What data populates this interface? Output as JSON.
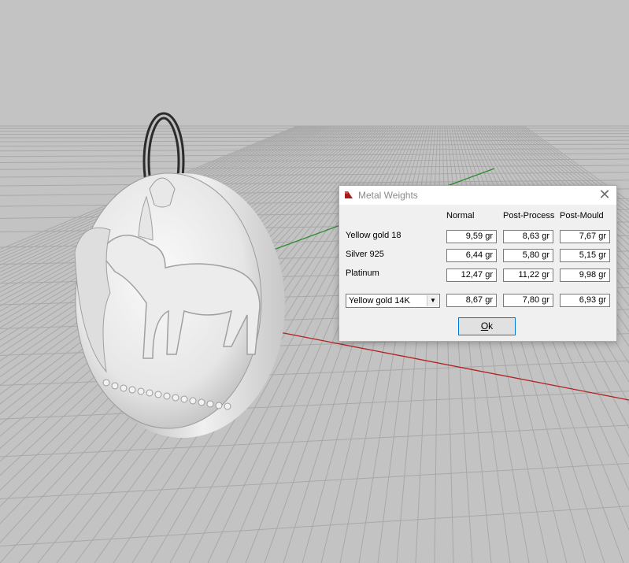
{
  "dialog": {
    "title": "Metal Weights",
    "columns": [
      "Normal",
      "Post-Process",
      "Post-Mould"
    ],
    "rows": [
      {
        "label": "Yellow gold 18",
        "values": [
          "9,59 gr",
          "8,63 gr",
          "7,67 gr"
        ]
      },
      {
        "label": "Silver 925",
        "values": [
          "6,44 gr",
          "5,80 gr",
          "5,15 gr"
        ]
      },
      {
        "label": "Platinum",
        "values": [
          "12,47 gr",
          "11,22 gr",
          "9,98 gr"
        ]
      }
    ],
    "custom": {
      "selected": "Yellow gold 14K",
      "values": [
        "8,67 gr",
        "7,80 gr",
        "6,93 gr"
      ]
    },
    "ok_label_first": "O",
    "ok_label_rest": "k",
    "close_glyph": "✕"
  },
  "colors": {
    "viewport_bg": "#c3c3c3",
    "grid": "#a8a8a8",
    "x_axis": "#b22222",
    "y_axis": "#2e8b2e",
    "accent": "#0078d7"
  }
}
